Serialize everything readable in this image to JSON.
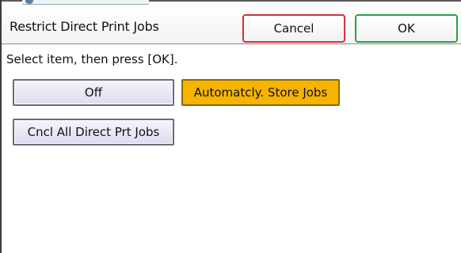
{
  "header": {
    "title": "Restrict Direct Print Jobs",
    "cancel_label": "Cancel",
    "ok_label": "OK"
  },
  "instruction": "Select item, then press [OK].",
  "options": [
    {
      "label": "Off",
      "selected": false
    },
    {
      "label": "Automatcly. Store Jobs",
      "selected": true
    },
    {
      "label": "Cncl All Direct Prt Jobs",
      "selected": false
    }
  ],
  "colors": {
    "selected_bg": "#f6b400",
    "cancel_border": "#d6303a",
    "ok_border": "#29a04a",
    "option_bg": "#e6e6f4"
  }
}
